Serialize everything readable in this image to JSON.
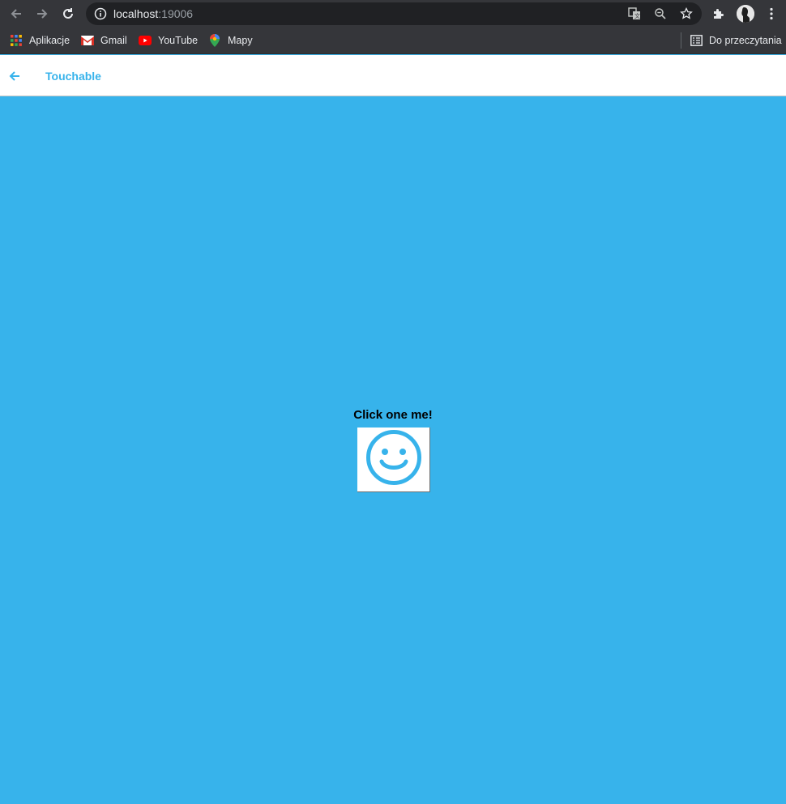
{
  "browser": {
    "url_host": "localhost",
    "url_port": ":19006",
    "bookmarks": [
      {
        "label": "Aplikacje",
        "icon": "apps-grid-icon"
      },
      {
        "label": "Gmail",
        "icon": "gmail-icon"
      },
      {
        "label": "YouTube",
        "icon": "youtube-icon"
      },
      {
        "label": "Mapy",
        "icon": "maps-pin-icon"
      }
    ],
    "reading_list": "Do przeczytania"
  },
  "header": {
    "title": "Touchable",
    "back_icon": "back-arrow-icon"
  },
  "main": {
    "prompt": "Click one me!",
    "touchable_icon": "smiley-face-icon"
  },
  "colors": {
    "accent": "#37b3eb",
    "background": "#37b3eb",
    "header_bg": "#ffffff"
  }
}
